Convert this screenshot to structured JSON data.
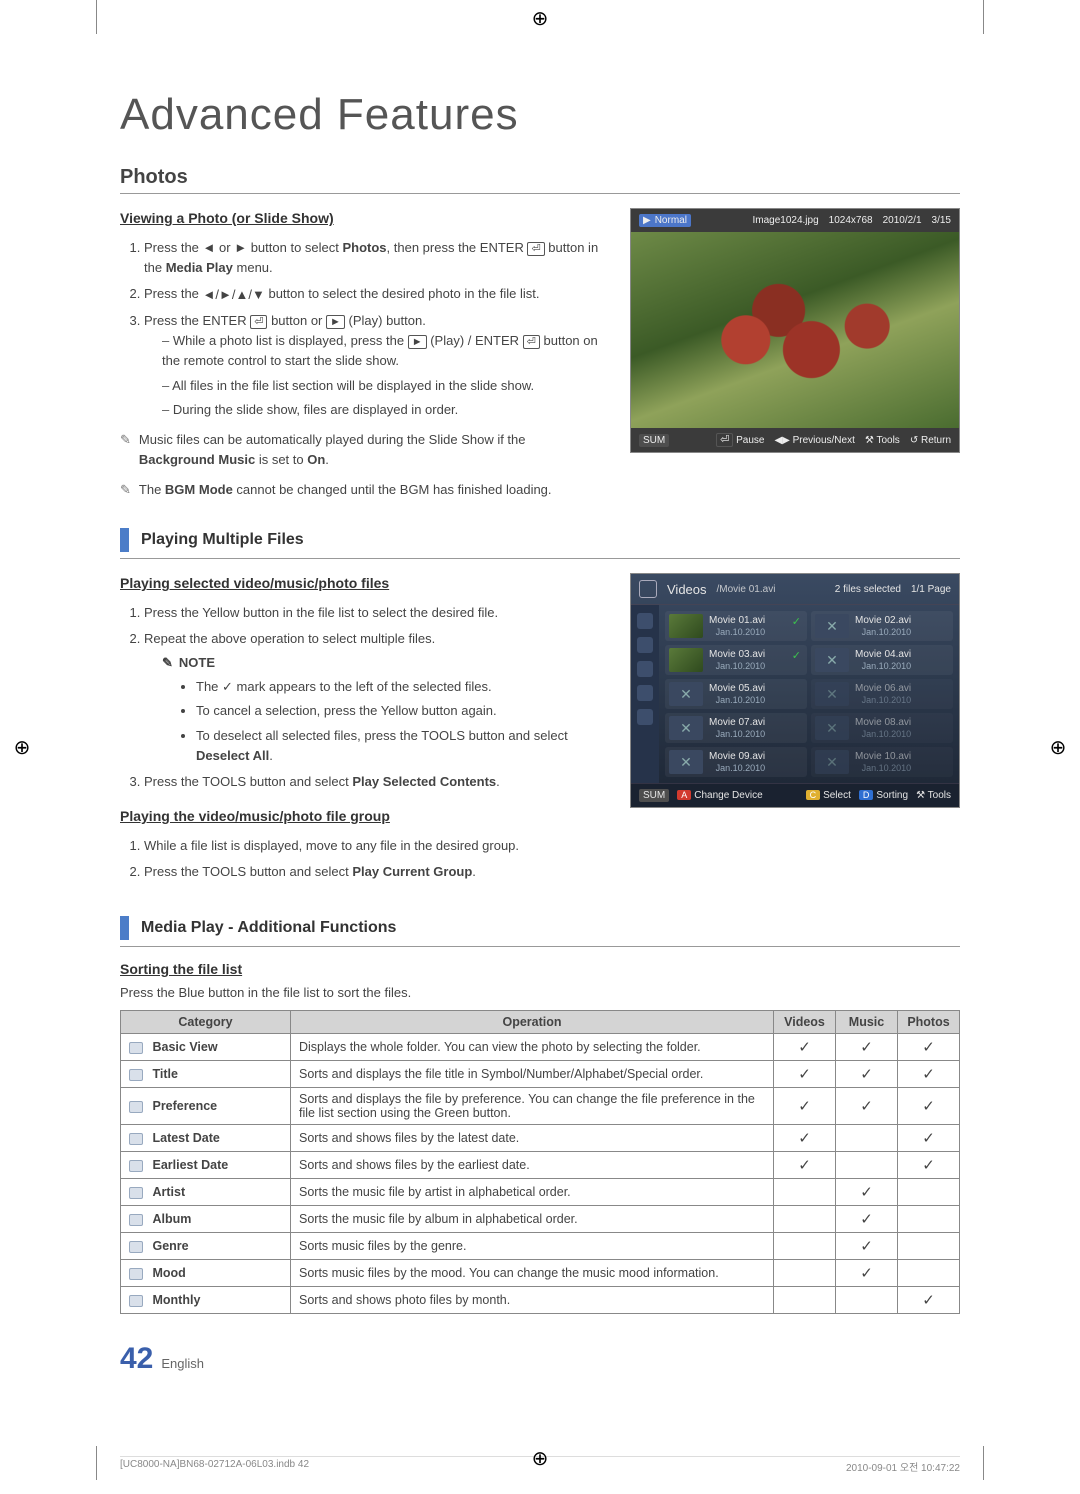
{
  "page": {
    "title": "Advanced Features",
    "section": "Photos",
    "number": "42",
    "language": "English",
    "footer_left": "[UC8000-NA]BN68-02712A-06L03.indb   42",
    "footer_right": "2010-09-01   오전 10:47:22"
  },
  "photos": {
    "subtitle": "Viewing a Photo (or Slide Show)",
    "step1_a": "Press the ",
    "step1_b": " or ",
    "step1_c": " button to select ",
    "step1_photos": "Photos",
    "step1_d": ", then press the ENTER",
    "step1_e": " button in the ",
    "step1_media": "Media Play",
    "step1_f": " menu.",
    "step2_a": "Press the ",
    "step2_b": " button to select the desired photo in the file list.",
    "step3_a": "Press the ENTER",
    "step3_b": " button or ",
    "step3_c": " (Play) button.",
    "dash1_a": "While a photo list is displayed, press the ",
    "dash1_b": " (Play) / ENTER",
    "dash1_c": " button on the remote control to start the slide show.",
    "dash2": "All files in the file list section will be displayed in the slide show.",
    "dash3": "During the slide show, files are displayed in order.",
    "note1_a": "Music files can be automatically played during the Slide Show if the ",
    "note1_bg": "Background Music",
    "note1_b": " is set to ",
    "note1_on": "On",
    "note1_c": ".",
    "note2_a": "The ",
    "note2_bgm": "BGM Mode",
    "note2_b": " cannot be changed until the BGM has finished loading."
  },
  "pv": {
    "normal": "Normal",
    "filename": "Image1024.jpg",
    "res": "1024x768",
    "date": "2010/2/1",
    "index": "3/15",
    "sum": "SUM",
    "pause": "Pause",
    "prevnext": "Previous/Next",
    "tools": "Tools",
    "return": "Return"
  },
  "multi": {
    "heading": "Playing Multiple Files",
    "sub1": "Playing selected video/music/photo files",
    "s1": "Press the Yellow button in the file list to select the desired file.",
    "s2": "Repeat the above operation to select multiple files.",
    "note_label": "NOTE",
    "b1_a": "The ",
    "b1_b": " mark appears to the left of the selected files.",
    "b2": "To cancel a selection, press the Yellow button again.",
    "b3_a": "To deselect all selected files, press the TOOLS button and select ",
    "b3_deselect": "Deselect All",
    "b3_b": ".",
    "s3_a": "Press the TOOLS button and select ",
    "s3_psc": "Play Selected Contents",
    "s3_b": ".",
    "sub2": "Playing the video/music/photo file group",
    "g1": "While a file list is displayed, move to any file in the desired group.",
    "g2_a": "Press the TOOLS button and select ",
    "g2_pcg": "Play Current Group",
    "g2_b": "."
  },
  "vd": {
    "title": "Videos",
    "path": "/Movie 01.avi",
    "selcount": "2 files selected",
    "page": "1/1 Page",
    "items": [
      {
        "name": "Movie 01.avi",
        "date": "Jan.10.2010",
        "thumb": "img",
        "sel": true
      },
      {
        "name": "Movie 02.avi",
        "date": "Jan.10.2010",
        "thumb": "ph",
        "sel": false
      },
      {
        "name": "Movie 03.avi",
        "date": "Jan.10.2010",
        "thumb": "img",
        "sel": true
      },
      {
        "name": "Movie 04.avi",
        "date": "Jan.10.2010",
        "thumb": "ph",
        "sel": false
      },
      {
        "name": "Movie 05.avi",
        "date": "Jan.10.2010",
        "thumb": "ph",
        "sel": false
      },
      {
        "name": "Movie 06.avi",
        "date": "Jan.10.2010",
        "thumb": "ph",
        "sel": false,
        "disabled": true
      },
      {
        "name": "Movie 07.avi",
        "date": "Jan.10.2010",
        "thumb": "ph",
        "sel": false
      },
      {
        "name": "Movie 08.avi",
        "date": "Jan.10.2010",
        "thumb": "ph",
        "sel": false,
        "disabled": true
      },
      {
        "name": "Movie 09.avi",
        "date": "Jan.10.2010",
        "thumb": "ph",
        "sel": false
      },
      {
        "name": "Movie 10.avi",
        "date": "Jan.10.2010",
        "thumb": "ph",
        "sel": false,
        "disabled": true
      }
    ],
    "sum": "SUM",
    "change": "Change Device",
    "select": "Select",
    "sorting": "Sorting",
    "tools": "Tools"
  },
  "add": {
    "heading": "Media Play - Additional Functions",
    "sort_sub": "Sorting the file list",
    "sort_intro": "Press the Blue button in the file list to sort the files.",
    "th_cat": "Category",
    "th_op": "Operation",
    "th_v": "Videos",
    "th_m": "Music",
    "th_p": "Photos",
    "rows": [
      {
        "cat": "Basic View",
        "op": "Displays the whole folder. You can view the photo by selecting the folder.",
        "v": true,
        "m": true,
        "p": true
      },
      {
        "cat": "Title",
        "op": "Sorts and displays the file title in Symbol/Number/Alphabet/Special order.",
        "v": true,
        "m": true,
        "p": true
      },
      {
        "cat": "Preference",
        "op": "Sorts and displays the file by preference. You can change the file preference in the file list section using the Green button.",
        "v": true,
        "m": true,
        "p": true
      },
      {
        "cat": "Latest Date",
        "op": "Sorts and shows files by the latest date.",
        "v": true,
        "m": false,
        "p": true
      },
      {
        "cat": "Earliest Date",
        "op": "Sorts and shows files by the earliest date.",
        "v": true,
        "m": false,
        "p": true
      },
      {
        "cat": "Artist",
        "op": "Sorts the music file by artist in alphabetical order.",
        "v": false,
        "m": true,
        "p": false
      },
      {
        "cat": "Album",
        "op": "Sorts the music file by album in alphabetical order.",
        "v": false,
        "m": true,
        "p": false
      },
      {
        "cat": "Genre",
        "op": "Sorts music files by the genre.",
        "v": false,
        "m": true,
        "p": false
      },
      {
        "cat": "Mood",
        "op": "Sorts music files by the mood. You can change the music mood information.",
        "v": false,
        "m": true,
        "p": false
      },
      {
        "cat": "Monthly",
        "op": "Sorts and shows photo files by month.",
        "v": false,
        "m": false,
        "p": true
      }
    ]
  },
  "glyphs": {
    "left": "◄",
    "right": "►",
    "up": "▲",
    "down": "▼",
    "enter": "⏎",
    "play": "►",
    "check": "✓",
    "note": "✎",
    "lrud": "◄/►/▲/▼",
    "arrows_lr": "◀▶"
  }
}
